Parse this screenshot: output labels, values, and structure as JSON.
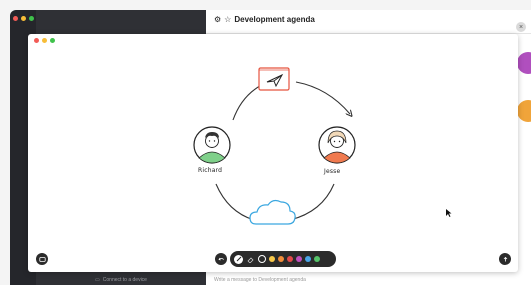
{
  "app": {
    "chat_title": "Development agenda",
    "footer_device_label": "Connect to a device",
    "footer_message_placeholder": "Write a message to Development agenda",
    "side_fragment": "card"
  },
  "whiteboard": {
    "people": [
      {
        "name": "Richard"
      },
      {
        "name": "Jesse"
      }
    ],
    "toolbar": {
      "tools": [
        "pen-icon",
        "eraser-icon"
      ],
      "colors": [
        "#ffffff",
        "#f7c84a",
        "#f08c3a",
        "#e2484a",
        "#c04fbf",
        "#4aa6e8",
        "#56c46a"
      ],
      "selected_color": "#ffffff"
    }
  },
  "colors": {
    "sidebar_dark": "#25262b",
    "list_dark": "#2f3035",
    "envelope_stroke": "#e5533f",
    "cloud_stroke": "#3aa7e0",
    "shirt_green": "#7fd08a",
    "shirt_orange": "#f07a4f"
  }
}
